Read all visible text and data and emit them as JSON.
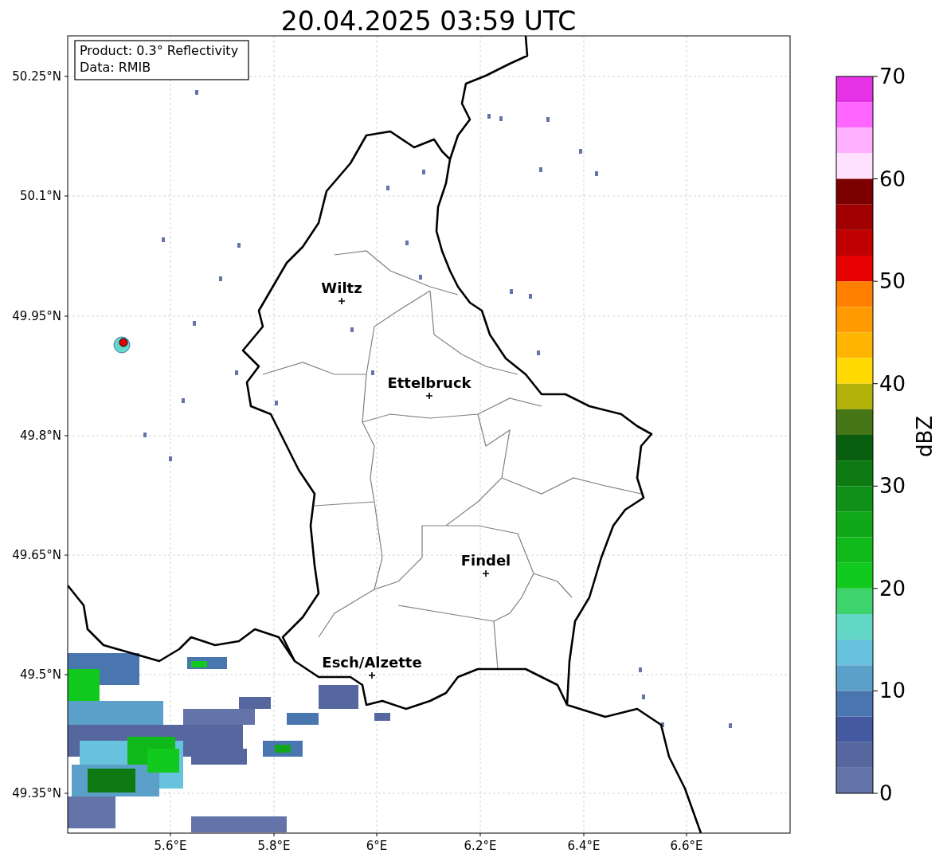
{
  "title": "20.04.2025 03:59 UTC",
  "info_box": [
    "Product: 0.3° Reflectivity",
    "Data: RMIB"
  ],
  "lat_ticks": [
    "50.25°N",
    "50.1°N",
    "49.95°N",
    "49.8°N",
    "49.65°N",
    "49.5°N",
    "49.35°N"
  ],
  "lon_ticks": [
    "5.6°E",
    "5.8°E",
    "6°E",
    "6.2°E",
    "6.4°E",
    "6.6°E"
  ],
  "places": [
    {
      "name": "Wiltz"
    },
    {
      "name": "Ettelbruck"
    },
    {
      "name": "Findel"
    },
    {
      "name": "Esch/Alzette"
    }
  ],
  "colorbar": {
    "label": "dBZ",
    "ticks": [
      "70",
      "60",
      "50",
      "40",
      "30",
      "20",
      "10",
      "0"
    ],
    "bins": [
      {
        "color": "#e632e6"
      },
      {
        "color": "#ff66ff"
      },
      {
        "color": "#ffb0ff"
      },
      {
        "color": "#ffe0ff"
      },
      {
        "color": "#7c0000"
      },
      {
        "color": "#a00000"
      },
      {
        "color": "#c00000"
      },
      {
        "color": "#e60000"
      },
      {
        "color": "#ff7f00"
      },
      {
        "color": "#ff9a00"
      },
      {
        "color": "#ffb400"
      },
      {
        "color": "#ffd900"
      },
      {
        "color": "#b2b20a"
      },
      {
        "color": "#457515"
      },
      {
        "color": "#0a5e10"
      },
      {
        "color": "#0d7a12"
      },
      {
        "color": "#0f9016"
      },
      {
        "color": "#10a818"
      },
      {
        "color": "#10b91a"
      },
      {
        "color": "#12c91e"
      },
      {
        "color": "#3dd46c"
      },
      {
        "color": "#64d8c6"
      },
      {
        "color": "#66c2dd"
      },
      {
        "color": "#5ba0c8"
      },
      {
        "color": "#4a76b0"
      },
      {
        "color": "#44599f"
      },
      {
        "color": "#56679f"
      },
      {
        "color": "#6474a8"
      }
    ]
  }
}
